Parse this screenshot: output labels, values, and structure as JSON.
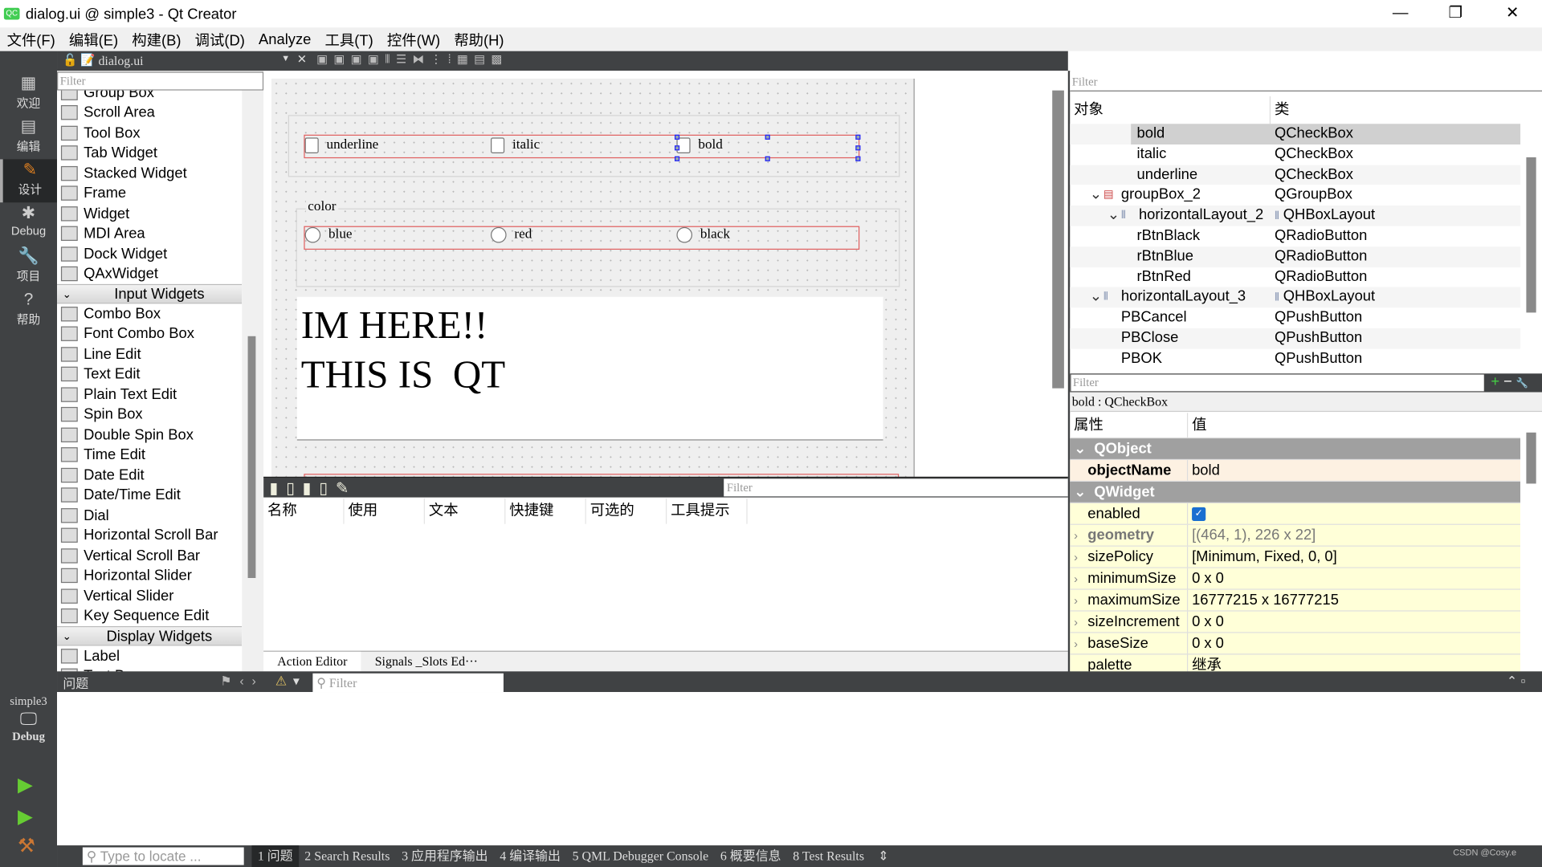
{
  "window": {
    "title": "dialog.ui @ simple3 - Qt Creator",
    "app_icon": "QC",
    "minimize": "—",
    "restore": "❐",
    "close": "✕"
  },
  "menu": [
    "文件(F)",
    "编辑(E)",
    "构建(B)",
    "调试(D)",
    "Analyze",
    "工具(T)",
    "控件(W)",
    "帮助(H)"
  ],
  "modes": [
    {
      "label": "欢迎",
      "icon": "grid-icon"
    },
    {
      "label": "编辑",
      "icon": "document-icon"
    },
    {
      "label": "设计",
      "icon": "pencil-icon"
    },
    {
      "label": "Debug",
      "icon": "bug-icon"
    },
    {
      "label": "项目",
      "icon": "wrench-icon"
    },
    {
      "label": "帮助",
      "icon": "help-icon"
    }
  ],
  "run_target": {
    "project": "simple3",
    "config": "Debug"
  },
  "editor_tab": {
    "file": "dialog.ui"
  },
  "widget_box": {
    "filter_placeholder": "Filter",
    "items_top": [
      "Group Box",
      "Scroll Area",
      "Tool Box",
      "Tab Widget",
      "Stacked Widget",
      "Frame",
      "Widget",
      "MDI Area",
      "Dock Widget",
      "QAxWidget"
    ],
    "cat_input": "Input Widgets",
    "items_input": [
      "Combo Box",
      "Font Combo Box",
      "Line Edit",
      "Text Edit",
      "Plain Text Edit",
      "Spin Box",
      "Double Spin Box",
      "Time Edit",
      "Date Edit",
      "Date/Time Edit",
      "Dial",
      "Horizontal Scroll Bar",
      "Vertical Scroll Bar",
      "Horizontal Slider",
      "Vertical Slider",
      "Key Sequence Edit"
    ],
    "cat_display": "Display Widgets",
    "items_display": [
      "Label",
      "Text B..."
    ]
  },
  "form": {
    "checkboxes": [
      "underline",
      "italic",
      "bold"
    ],
    "color_group_title": "color",
    "radios": [
      "blue",
      "red",
      "black"
    ],
    "text_lines": "IM HERE!!\nTHIS IS  QT"
  },
  "action_editor": {
    "filter_placeholder": "Filter",
    "columns": [
      "名称",
      "使用",
      "文本",
      "快捷键",
      "可选的",
      "工具提示"
    ],
    "tabs": [
      "Action Editor",
      "Signals _Slots Ed···"
    ]
  },
  "object_inspector": {
    "filter_placeholder": "Filter",
    "col_object": "对象",
    "col_class": "类",
    "rows": [
      {
        "name": "bold",
        "class": "QCheckBox",
        "indent": 3,
        "selected": true
      },
      {
        "name": "italic",
        "class": "QCheckBox",
        "indent": 3
      },
      {
        "name": "underline",
        "class": "QCheckBox",
        "indent": 3
      },
      {
        "name": "groupBox_2",
        "class": "QGroupBox",
        "indent": 1,
        "expand": "⌄"
      },
      {
        "name": "horizontalLayout_2",
        "class": "QHBoxLayout",
        "indent": 2,
        "expand": "⌄"
      },
      {
        "name": "rBtnBlack",
        "class": "QRadioButton",
        "indent": 3
      },
      {
        "name": "rBtnBlue",
        "class": "QRadioButton",
        "indent": 3
      },
      {
        "name": "rBtnRed",
        "class": "QRadioButton",
        "indent": 3
      },
      {
        "name": "horizontalLayout_3",
        "class": "QHBoxLayout",
        "indent": 1,
        "expand": "⌄"
      },
      {
        "name": "PBCancel",
        "class": "QPushButton",
        "indent": 2
      },
      {
        "name": "PBClose",
        "class": "QPushButton",
        "indent": 2
      },
      {
        "name": "PBOK",
        "class": "QPushButton",
        "indent": 2
      }
    ]
  },
  "property_editor": {
    "filter_placeholder": "Filter",
    "add": "+",
    "remove": "−",
    "configure": "🔧",
    "selected_label": "bold : QCheckBox",
    "col_property": "属性",
    "col_value": "值",
    "rows": [
      {
        "type": "group",
        "key": "QObject"
      },
      {
        "type": "o",
        "key": "objectName",
        "value": "bold",
        "bold": true
      },
      {
        "type": "group",
        "key": "QWidget"
      },
      {
        "type": "y",
        "key": "enabled",
        "checkbox": true
      },
      {
        "type": "y",
        "key": "geometry",
        "value": "[(464, 1), 226 x 22]",
        "exp": true,
        "grey": true
      },
      {
        "type": "y",
        "key": "sizePolicy",
        "value": "[Minimum, Fixed, 0, 0]",
        "exp": true
      },
      {
        "type": "y",
        "key": "minimumSize",
        "value": "0 x 0",
        "exp": true
      },
      {
        "type": "y",
        "key": "maximumSize",
        "value": "16777215 x 16777215",
        "exp": true
      },
      {
        "type": "y",
        "key": "sizeIncrement",
        "value": "0 x 0",
        "exp": true
      },
      {
        "type": "y",
        "key": "baseSize",
        "value": "0 x 0",
        "exp": true
      },
      {
        "type": "y",
        "key": "palette",
        "value": "继承"
      }
    ]
  },
  "issues": {
    "title": "问题",
    "filter_placeholder": "Filter"
  },
  "status": {
    "locate_placeholder": "Type to locate ...",
    "tabs": [
      "1 问题",
      "2 Search Results",
      "3 应用程序输出",
      "4 编译输出",
      "5 QML Debugger Console",
      "6 概要信息",
      "8 Test Results"
    ],
    "watermark": "CSDN @Cosy.e"
  }
}
